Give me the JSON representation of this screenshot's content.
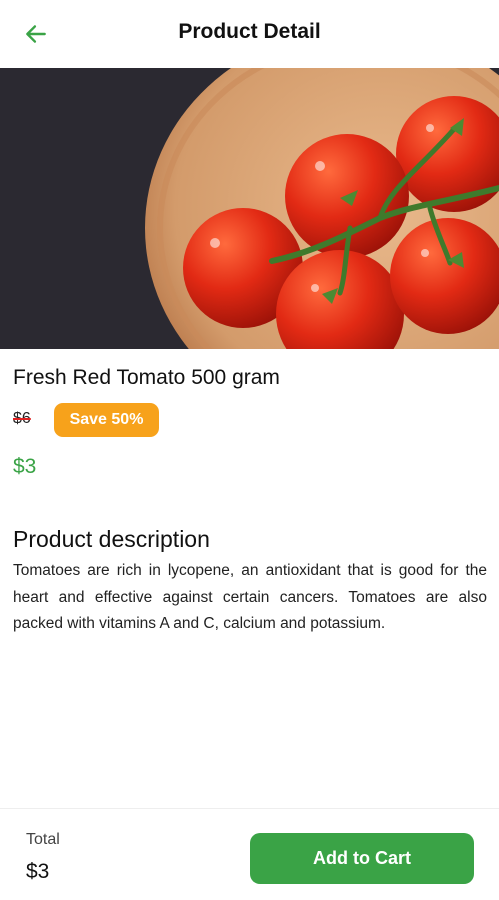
{
  "header": {
    "title": "Product Detail",
    "back_icon": "arrow-left-icon",
    "back_color": "#3aa346"
  },
  "hero_image": {
    "subject": "red tomatoes on the vine in a wooden bowl"
  },
  "product": {
    "name": "Fresh Red Tomato 500 gram",
    "old_price": "$6",
    "save_label": "Save 50%",
    "price": "$3"
  },
  "description": {
    "title": "Product description",
    "text": "Tomatoes are rich in lycopene, an antioxidant that is good for the heart and effective against certain cancers. Tomatoes are also packed with vitamins A and C, calcium and potassium."
  },
  "footer": {
    "total_label": "Total",
    "total_value": "$3",
    "cart_button_label": "Add to Cart"
  },
  "colors": {
    "accent_green": "#3aa346",
    "badge_orange": "#f7a21b",
    "strike_red": "#e02020"
  }
}
